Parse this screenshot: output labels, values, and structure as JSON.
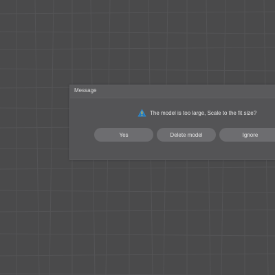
{
  "dialog": {
    "title": "Message",
    "icon": "warning-icon",
    "message": "The model is too large, Scale to the fit size?",
    "buttons": {
      "yes": "Yes",
      "delete": "Delete model",
      "ignore": "Ignore"
    }
  },
  "colors": {
    "background": "#4a4a4b",
    "grid_line": "#555557",
    "dialog_bg": "#545456",
    "button_bg": "#6d6d70",
    "icon_blue": "#2f8fd8",
    "icon_yellow": "#f3c33a"
  }
}
